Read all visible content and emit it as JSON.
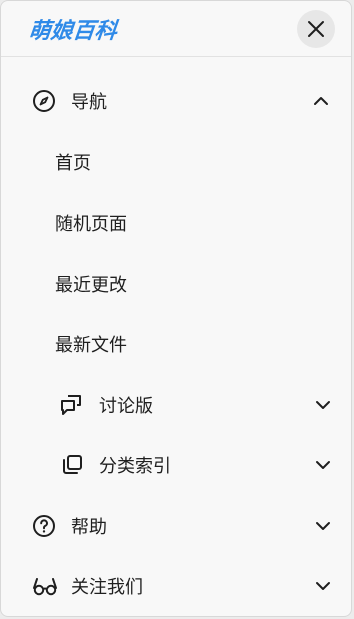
{
  "header": {
    "logo_text": "萌娘百科"
  },
  "nav": {
    "section_label": "导航",
    "links": [
      "首页",
      "随机页面",
      "最近更改",
      "最新文件"
    ],
    "sub_groups": [
      {
        "label": "讨论版",
        "icon": "discussion-icon"
      },
      {
        "label": "分类索引",
        "icon": "category-icon"
      }
    ]
  },
  "sections": [
    {
      "label": "帮助",
      "icon": "help-icon"
    },
    {
      "label": "关注我们",
      "icon": "glasses-icon"
    }
  ],
  "colors": {
    "logo": "#2f8ae8",
    "text": "#1f1f1f",
    "panel_bg": "#f8f8f8"
  }
}
